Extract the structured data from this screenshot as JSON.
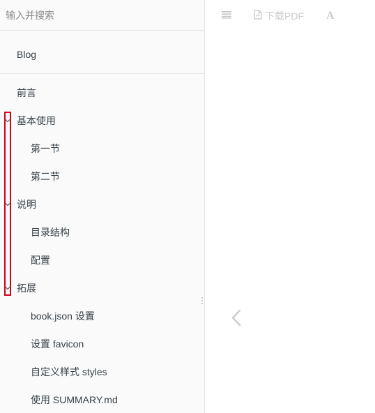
{
  "search": {
    "placeholder": "输入并搜索"
  },
  "sidebar": {
    "top_link": "Blog",
    "items": [
      {
        "label": "前言",
        "level": 0
      },
      {
        "label": "基本使用",
        "level": 0,
        "expanded": true
      },
      {
        "label": "第一节",
        "level": 1
      },
      {
        "label": "第二节",
        "level": 1
      },
      {
        "label": "说明",
        "level": 0,
        "expanded": true
      },
      {
        "label": "目录结构",
        "level": 1
      },
      {
        "label": "配置",
        "level": 1
      },
      {
        "label": "拓展",
        "level": 0,
        "expanded": true
      },
      {
        "label": "book.json 设置",
        "level": 1
      },
      {
        "label": "设置 favicon",
        "level": 1
      },
      {
        "label": "自定义样式 styles",
        "level": 1
      },
      {
        "label": "使用 SUMMARY.md",
        "level": 1
      }
    ]
  },
  "toolbar": {
    "menu_icon": "hamburger-icon",
    "pdf_label": "下载PDF",
    "pdf_icon": "file-icon",
    "font_icon": "A"
  },
  "navigation": {
    "prev_icon": "chevron-left-icon"
  },
  "colors": {
    "accent_outline": "#d0021b",
    "sidebar_bg": "#fafafa",
    "icon_gray": "#cccccc"
  }
}
